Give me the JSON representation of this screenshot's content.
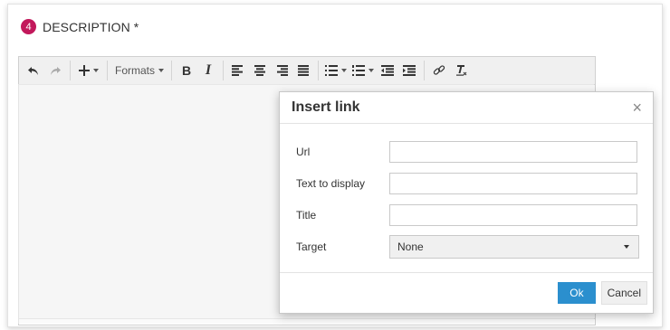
{
  "section": {
    "number": "4",
    "title": "DESCRIPTION *",
    "badge_color": "#c2185b"
  },
  "toolbar": {
    "formats_label": "Formats",
    "bold_label": "B",
    "italic_label": "I",
    "icons": [
      "undo-icon",
      "redo-icon",
      "insert-icon",
      "align-left-icon",
      "align-center-icon",
      "align-right-icon",
      "align-justify-icon",
      "bullet-list-icon",
      "numbered-list-icon",
      "outdent-icon",
      "indent-icon",
      "link-icon",
      "clear-formatting-icon"
    ]
  },
  "dialog": {
    "title": "Insert link",
    "close_symbol": "×",
    "fields": {
      "url_label": "Url",
      "url_value": "",
      "text_label": "Text to display",
      "text_value": "",
      "title_label": "Title",
      "title_value": "",
      "target_label": "Target",
      "target_value": "None"
    },
    "ok_label": "Ok",
    "cancel_label": "Cancel",
    "ok_color": "#2b8fce"
  }
}
